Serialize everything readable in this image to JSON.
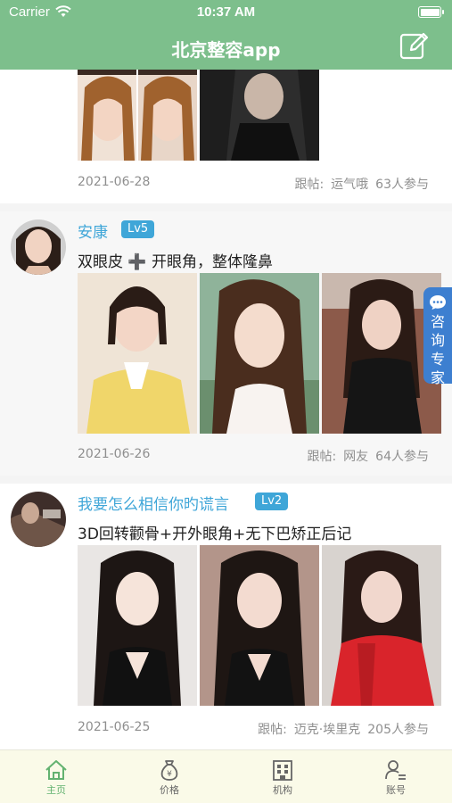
{
  "status_bar": {
    "carrier": "Carrier",
    "time": "10:37 AM"
  },
  "nav": {
    "title": "北京整容app",
    "edit_icon": "edit-icon"
  },
  "posts": [
    {
      "date": "2021-06-28",
      "follow_label": "跟帖:",
      "follower": "运气哦",
      "participants": "63人参与"
    },
    {
      "user": "安康",
      "level": "Lv5",
      "title": "双眼皮 ➕ 开眼角，整体隆鼻",
      "date": "2021-06-26",
      "follow_label": "跟帖:",
      "follower": "网友",
      "participants": "64人参与"
    },
    {
      "user": "我要怎么相信你旳谎言",
      "level": "Lv2",
      "title": "3D回转颧骨+开外眼角+无下巴矫正后记",
      "date": "2021-06-25",
      "follow_label": "跟帖:",
      "follower": "迈克·埃里克",
      "participants": "205人参与"
    }
  ],
  "consult": {
    "label_1": "咨",
    "label_2": "询",
    "label_3": "专",
    "label_4": "家"
  },
  "tabs": [
    {
      "label": "主页",
      "icon": "home-icon"
    },
    {
      "label": "价格",
      "icon": "money-bag-icon"
    },
    {
      "label": "机构",
      "icon": "building-icon"
    },
    {
      "label": "账号",
      "icon": "user-list-icon"
    }
  ],
  "colors": {
    "nav": "#7dbf8c",
    "link": "#3fa6d8",
    "tab_active": "#63b270",
    "consult": "#3d7fd0"
  }
}
